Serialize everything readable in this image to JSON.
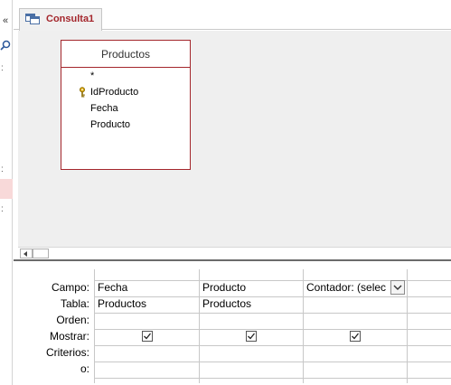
{
  "nav": {
    "collapse_glyph": "«"
  },
  "tab": {
    "label": "Consulta1"
  },
  "table_box": {
    "title": "Productos",
    "fields": [
      "*",
      "IdProducto",
      "Fecha",
      "Producto"
    ]
  },
  "qbe": {
    "row_labels": [
      "Campo:",
      "Tabla:",
      "Orden:",
      "Mostrar:",
      "Criterios:",
      "o:"
    ],
    "columns": [
      {
        "campo": "Fecha",
        "tabla": "Productos",
        "mostrar": true
      },
      {
        "campo": "Producto",
        "tabla": "Productos",
        "mostrar": true
      },
      {
        "campo": "Contador: (selec",
        "tabla": "",
        "mostrar": true
      }
    ]
  },
  "colors": {
    "accent": "#a4262c",
    "surface": "#efefef",
    "nav_selection": "#f8d9d9"
  },
  "icons": {
    "tab": "query-icon",
    "primary_key": "key-icon",
    "search": "search-icon"
  }
}
